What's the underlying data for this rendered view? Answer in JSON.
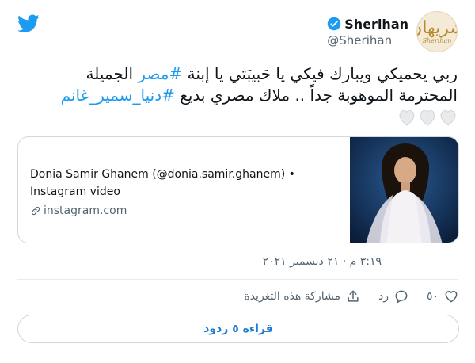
{
  "author": {
    "name": "Sherihan",
    "handle": "@Sherihan",
    "avatar_text": "شريهان",
    "avatar_sub": "Sherihan"
  },
  "tweet": {
    "line1_before": "ربي يحميكي ويبارك فيكي يا حَبيبَتي يا إبنة ",
    "line1_hashtag": "#مصر",
    "line1_after": " الجميلة",
    "line2_before": "المحترمة الموهوبة جداً .. ملاك مصري بديع ",
    "line2_hashtag": "#دنيا_سمير_غانم",
    "hearts_count": 3
  },
  "card": {
    "title": "Donia Samir Ghanem (@donia.samir.ghanem) •",
    "subtitle": "Instagram video",
    "domain": "instagram.com"
  },
  "timestamp": "٣:١٩ م · ٢١ ديسمبر ٢٠٢١",
  "actions": {
    "like_count": "٥٠",
    "reply_label": "رد",
    "share_label": "مشاركة هذه التغريدة"
  },
  "read_replies_label": "قراءة ٥ ردود",
  "colors": {
    "twitter_blue": "#1d9bf0",
    "link_blue": "#1d7bd0",
    "muted": "#536471"
  }
}
